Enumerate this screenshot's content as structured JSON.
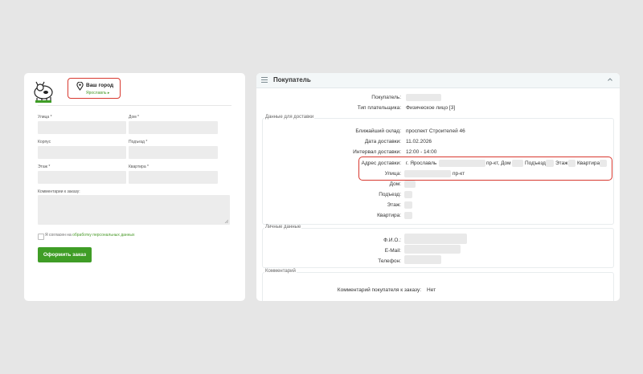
{
  "checkout": {
    "city_title": "Ваш город",
    "city_value": "Ярославль ▸",
    "street_label": "Улица *",
    "house_label": "Дом *",
    "building_label": "Корпус",
    "entrance_label": "Подъезд *",
    "floor_label": "Этаж *",
    "apartment_label": "Квартира *",
    "comment_label": "Комментарии к заказу:",
    "agree_prefix": "Я согласен на ",
    "agree_link": "обработку персональных данных",
    "order_button": "Оформить заказ"
  },
  "crm": {
    "header_title": "Покупатель",
    "buyer_label": "Покупатель:",
    "payer_type_label": "Тип плательщика:",
    "payer_type_value": "Физическое лицо [3]",
    "delivery_section": "Данные для доставки",
    "warehouse_label": "Ближайший склад:",
    "warehouse_value": "проспект Строителей 46",
    "delivery_date_label": "Дата доставки:",
    "delivery_date_value": "11.02.2026",
    "interval_label": "Интервал доставки:",
    "interval_value": "12:00 - 14:00",
    "address_label": "Адрес доставки:",
    "address_city": "г. Ярославль",
    "address_suffix": "пр-кт, Дом",
    "address_entrance": "Подъезд",
    "address_floor": "Этаж",
    "address_apartment": "Квартира",
    "street_label": "Улица:",
    "street_suffix": "пр-кт",
    "house_label": "Дом:",
    "entrance_label": "Подъезд:",
    "floor_label": "Этаж:",
    "apartment_label": "Квартира:",
    "personal_section": "Личные данные",
    "name_label": "Ф.И.О.:",
    "email_label": "E-Mail:",
    "phone_label": "Телефон:",
    "comment_section": "Комментарий",
    "buyer_comment_label": "Комментарий покупателя к заказу:",
    "buyer_comment_value": "Нет"
  },
  "colors": {
    "accent_green": "#3f9d26",
    "highlight_red": "#d8382f"
  }
}
